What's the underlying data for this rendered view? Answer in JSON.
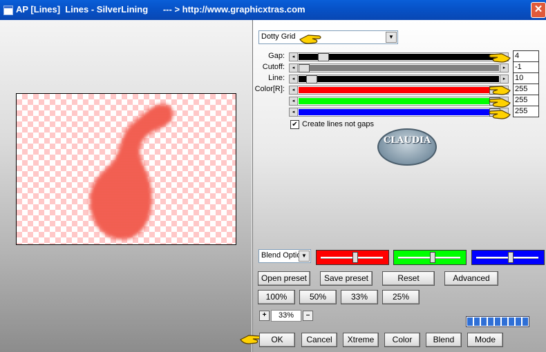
{
  "window": {
    "title": "AP [Lines]  Lines - SilverLining      --- > http://www.graphicxtras.com",
    "close_glyph": "✕"
  },
  "preset_dropdown": {
    "value": "Dotty Grid",
    "arrow": "▼"
  },
  "sliders": [
    {
      "label": "Gap:",
      "value": "4",
      "fill_color": "#000000",
      "fill_fraction": 1.0,
      "thumb_fraction": 0.1
    },
    {
      "label": "Cutoff:",
      "value": "-1",
      "fill_color": "#808080",
      "fill_fraction": 1.0,
      "thumb_fraction": 0.0
    },
    {
      "label": "Line:",
      "value": "10",
      "fill_color": "#000000",
      "fill_fraction": 1.0,
      "thumb_fraction": 0.04
    },
    {
      "label": "Color[R]:",
      "value": "255",
      "fill_color": "#ff0000",
      "fill_fraction": 1.0,
      "thumb_fraction": 1.0
    },
    {
      "label": "",
      "value": "255",
      "fill_color": "#00ff00",
      "fill_fraction": 1.0,
      "thumb_fraction": 1.0
    },
    {
      "label": "",
      "value": "255",
      "fill_color": "#0000ff",
      "fill_fraction": 1.0,
      "thumb_fraction": 1.0
    }
  ],
  "slider_glyphs": {
    "left": "◂",
    "right": "▸"
  },
  "checkbox": {
    "label": "Create lines not gaps",
    "checked": true,
    "mark": "✔"
  },
  "logo": {
    "text": "CLAUDIA"
  },
  "blend_dropdown": {
    "value": "Blend Optio",
    "arrow": "▼"
  },
  "color_sliders": [
    {
      "color": "#ff0000",
      "knob_fraction": 0.55
    },
    {
      "color": "#00ff00",
      "knob_fraction": 0.55
    },
    {
      "color": "#0000ff",
      "knob_fraction": 0.55
    }
  ],
  "buttons": {
    "open_preset": "Open preset",
    "save_preset": "Save preset",
    "reset": "Reset",
    "advanced": "Advanced",
    "zoom100": "100%",
    "zoom50": "50%",
    "zoom33": "33%",
    "zoom25": "25%",
    "ok": "OK",
    "cancel": "Cancel",
    "xtreme": "Xtreme",
    "color": "Color",
    "blend": "Blend",
    "mode": "Mode"
  },
  "zoom": {
    "plus": "+",
    "minus": "–",
    "value": "33%"
  },
  "progress": {
    "segments": 9
  },
  "icons": [
    "pointing-hand-icon",
    "close-icon",
    "checkbox-icon",
    "chevron-down-icon"
  ],
  "colors": {
    "accent": "#0753c9",
    "shape": "#f05040",
    "checker": "#ffc8c8"
  }
}
